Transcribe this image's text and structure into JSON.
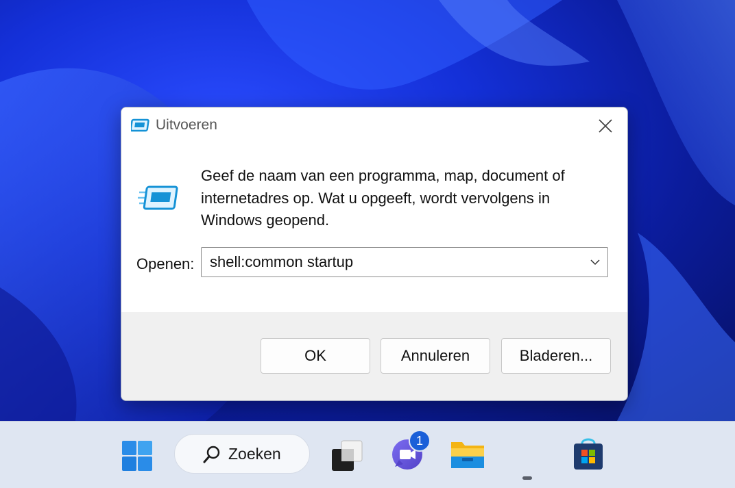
{
  "dialog": {
    "title": "Uitvoeren",
    "description": "Geef de naam van een programma, map, document of internetadres op. Wat u opgeeft, wordt vervolgens in Windows geopend.",
    "open_label": "Openen:",
    "open_value": "shell:common startup",
    "buttons": {
      "ok": "OK",
      "cancel": "Annuleren",
      "browse": "Bladeren..."
    }
  },
  "taskbar": {
    "search_label": "Zoeken",
    "chat_badge": "1",
    "icons": [
      "windows-start-icon",
      "search-icon",
      "task-view-icon",
      "chat-icon",
      "file-explorer-icon",
      "microsoft-store-icon"
    ]
  },
  "colors": {
    "accent": "#1a5fd8",
    "taskbar_bg": "#dfe6f2",
    "dialog_footer": "#f0f0f0"
  }
}
